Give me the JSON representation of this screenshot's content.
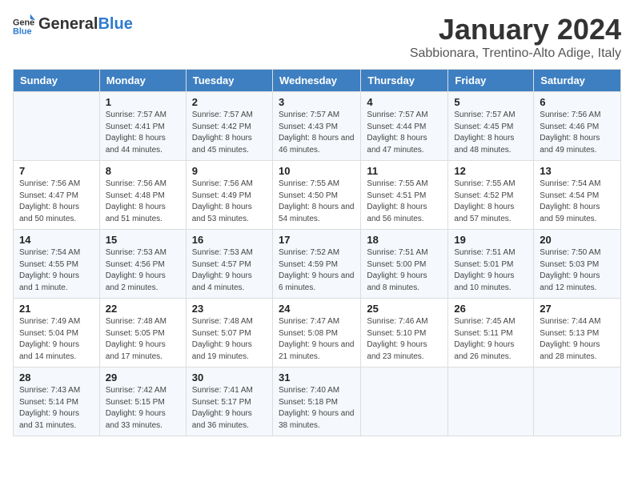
{
  "logo": {
    "general": "General",
    "blue": "Blue"
  },
  "header": {
    "month": "January 2024",
    "location": "Sabbionara, Trentino-Alto Adige, Italy"
  },
  "weekdays": [
    "Sunday",
    "Monday",
    "Tuesday",
    "Wednesday",
    "Thursday",
    "Friday",
    "Saturday"
  ],
  "weeks": [
    [
      {
        "day": "",
        "sunrise": "",
        "sunset": "",
        "daylight": ""
      },
      {
        "day": "1",
        "sunrise": "Sunrise: 7:57 AM",
        "sunset": "Sunset: 4:41 PM",
        "daylight": "Daylight: 8 hours and 44 minutes."
      },
      {
        "day": "2",
        "sunrise": "Sunrise: 7:57 AM",
        "sunset": "Sunset: 4:42 PM",
        "daylight": "Daylight: 8 hours and 45 minutes."
      },
      {
        "day": "3",
        "sunrise": "Sunrise: 7:57 AM",
        "sunset": "Sunset: 4:43 PM",
        "daylight": "Daylight: 8 hours and 46 minutes."
      },
      {
        "day": "4",
        "sunrise": "Sunrise: 7:57 AM",
        "sunset": "Sunset: 4:44 PM",
        "daylight": "Daylight: 8 hours and 47 minutes."
      },
      {
        "day": "5",
        "sunrise": "Sunrise: 7:57 AM",
        "sunset": "Sunset: 4:45 PM",
        "daylight": "Daylight: 8 hours and 48 minutes."
      },
      {
        "day": "6",
        "sunrise": "Sunrise: 7:56 AM",
        "sunset": "Sunset: 4:46 PM",
        "daylight": "Daylight: 8 hours and 49 minutes."
      }
    ],
    [
      {
        "day": "7",
        "sunrise": "Sunrise: 7:56 AM",
        "sunset": "Sunset: 4:47 PM",
        "daylight": "Daylight: 8 hours and 50 minutes."
      },
      {
        "day": "8",
        "sunrise": "Sunrise: 7:56 AM",
        "sunset": "Sunset: 4:48 PM",
        "daylight": "Daylight: 8 hours and 51 minutes."
      },
      {
        "day": "9",
        "sunrise": "Sunrise: 7:56 AM",
        "sunset": "Sunset: 4:49 PM",
        "daylight": "Daylight: 8 hours and 53 minutes."
      },
      {
        "day": "10",
        "sunrise": "Sunrise: 7:55 AM",
        "sunset": "Sunset: 4:50 PM",
        "daylight": "Daylight: 8 hours and 54 minutes."
      },
      {
        "day": "11",
        "sunrise": "Sunrise: 7:55 AM",
        "sunset": "Sunset: 4:51 PM",
        "daylight": "Daylight: 8 hours and 56 minutes."
      },
      {
        "day": "12",
        "sunrise": "Sunrise: 7:55 AM",
        "sunset": "Sunset: 4:52 PM",
        "daylight": "Daylight: 8 hours and 57 minutes."
      },
      {
        "day": "13",
        "sunrise": "Sunrise: 7:54 AM",
        "sunset": "Sunset: 4:54 PM",
        "daylight": "Daylight: 8 hours and 59 minutes."
      }
    ],
    [
      {
        "day": "14",
        "sunrise": "Sunrise: 7:54 AM",
        "sunset": "Sunset: 4:55 PM",
        "daylight": "Daylight: 9 hours and 1 minute."
      },
      {
        "day": "15",
        "sunrise": "Sunrise: 7:53 AM",
        "sunset": "Sunset: 4:56 PM",
        "daylight": "Daylight: 9 hours and 2 minutes."
      },
      {
        "day": "16",
        "sunrise": "Sunrise: 7:53 AM",
        "sunset": "Sunset: 4:57 PM",
        "daylight": "Daylight: 9 hours and 4 minutes."
      },
      {
        "day": "17",
        "sunrise": "Sunrise: 7:52 AM",
        "sunset": "Sunset: 4:59 PM",
        "daylight": "Daylight: 9 hours and 6 minutes."
      },
      {
        "day": "18",
        "sunrise": "Sunrise: 7:51 AM",
        "sunset": "Sunset: 5:00 PM",
        "daylight": "Daylight: 9 hours and 8 minutes."
      },
      {
        "day": "19",
        "sunrise": "Sunrise: 7:51 AM",
        "sunset": "Sunset: 5:01 PM",
        "daylight": "Daylight: 9 hours and 10 minutes."
      },
      {
        "day": "20",
        "sunrise": "Sunrise: 7:50 AM",
        "sunset": "Sunset: 5:03 PM",
        "daylight": "Daylight: 9 hours and 12 minutes."
      }
    ],
    [
      {
        "day": "21",
        "sunrise": "Sunrise: 7:49 AM",
        "sunset": "Sunset: 5:04 PM",
        "daylight": "Daylight: 9 hours and 14 minutes."
      },
      {
        "day": "22",
        "sunrise": "Sunrise: 7:48 AM",
        "sunset": "Sunset: 5:05 PM",
        "daylight": "Daylight: 9 hours and 17 minutes."
      },
      {
        "day": "23",
        "sunrise": "Sunrise: 7:48 AM",
        "sunset": "Sunset: 5:07 PM",
        "daylight": "Daylight: 9 hours and 19 minutes."
      },
      {
        "day": "24",
        "sunrise": "Sunrise: 7:47 AM",
        "sunset": "Sunset: 5:08 PM",
        "daylight": "Daylight: 9 hours and 21 minutes."
      },
      {
        "day": "25",
        "sunrise": "Sunrise: 7:46 AM",
        "sunset": "Sunset: 5:10 PM",
        "daylight": "Daylight: 9 hours and 23 minutes."
      },
      {
        "day": "26",
        "sunrise": "Sunrise: 7:45 AM",
        "sunset": "Sunset: 5:11 PM",
        "daylight": "Daylight: 9 hours and 26 minutes."
      },
      {
        "day": "27",
        "sunrise": "Sunrise: 7:44 AM",
        "sunset": "Sunset: 5:13 PM",
        "daylight": "Daylight: 9 hours and 28 minutes."
      }
    ],
    [
      {
        "day": "28",
        "sunrise": "Sunrise: 7:43 AM",
        "sunset": "Sunset: 5:14 PM",
        "daylight": "Daylight: 9 hours and 31 minutes."
      },
      {
        "day": "29",
        "sunrise": "Sunrise: 7:42 AM",
        "sunset": "Sunset: 5:15 PM",
        "daylight": "Daylight: 9 hours and 33 minutes."
      },
      {
        "day": "30",
        "sunrise": "Sunrise: 7:41 AM",
        "sunset": "Sunset: 5:17 PM",
        "daylight": "Daylight: 9 hours and 36 minutes."
      },
      {
        "day": "31",
        "sunrise": "Sunrise: 7:40 AM",
        "sunset": "Sunset: 5:18 PM",
        "daylight": "Daylight: 9 hours and 38 minutes."
      },
      {
        "day": "",
        "sunrise": "",
        "sunset": "",
        "daylight": ""
      },
      {
        "day": "",
        "sunrise": "",
        "sunset": "",
        "daylight": ""
      },
      {
        "day": "",
        "sunrise": "",
        "sunset": "",
        "daylight": ""
      }
    ]
  ]
}
